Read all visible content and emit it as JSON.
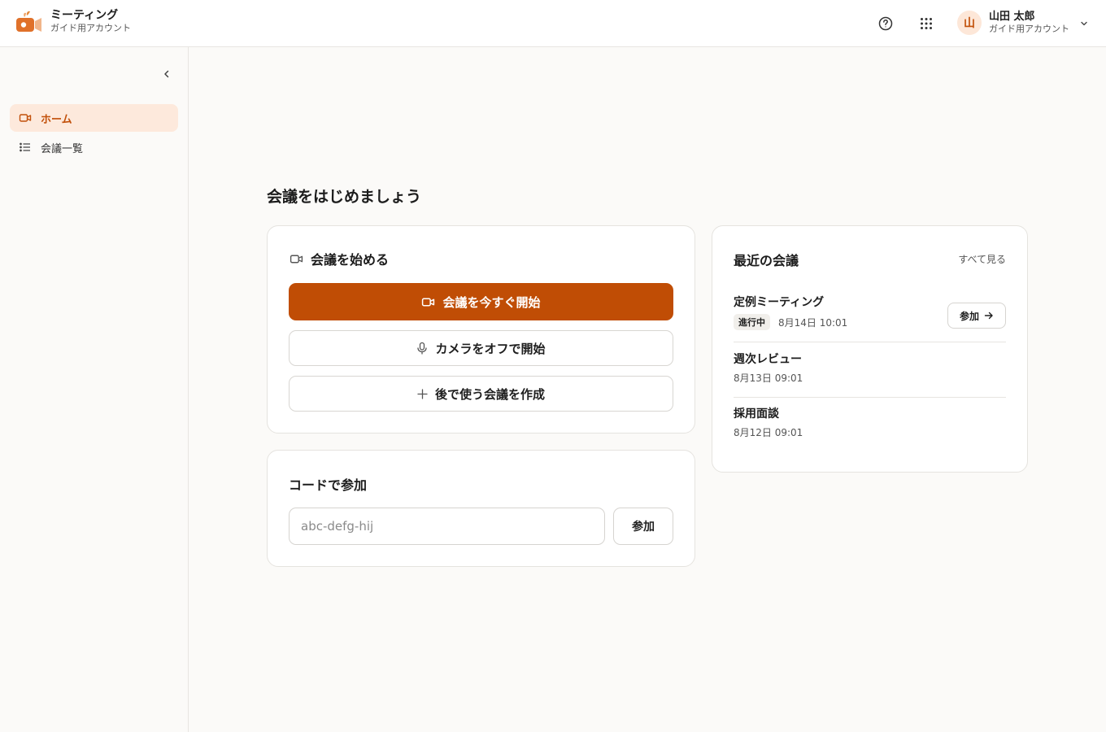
{
  "header": {
    "app_title": "ミーティング",
    "app_subtitle": "ガイド用アカウント",
    "user_initial": "山",
    "user_name": "山田 太郎",
    "user_account": "ガイド用アカウント"
  },
  "sidebar": {
    "items": [
      {
        "label": "ホーム",
        "icon": "video-icon",
        "active": true
      },
      {
        "label": "会議一覧",
        "icon": "list-icon",
        "active": false
      }
    ]
  },
  "main": {
    "page_title": "会議をはじめましょう",
    "start_card": {
      "title": "会議を始める",
      "start_now": "会議を今すぐ開始",
      "camera_off": "カメラをオフで開始",
      "create_later": "後で使う会議を作成"
    },
    "code_card": {
      "title": "コードで参加",
      "placeholder": "abc-defg-hij",
      "join_label": "参加"
    },
    "recent_card": {
      "title": "最近の会議",
      "see_all": "すべて見る",
      "meetings": [
        {
          "title": "定例ミーティング",
          "badge": "進行中",
          "time": "8月14日 10:01",
          "join_label": "参加"
        },
        {
          "title": "週次レビュー",
          "time": "8月13日 09:01"
        },
        {
          "title": "採用面談",
          "time": "8月12日 09:01"
        }
      ]
    }
  },
  "colors": {
    "accent": "#c04d05",
    "accent_soft": "#fde9dc",
    "background": "#fbfaf8",
    "border": "#e5e3df"
  }
}
